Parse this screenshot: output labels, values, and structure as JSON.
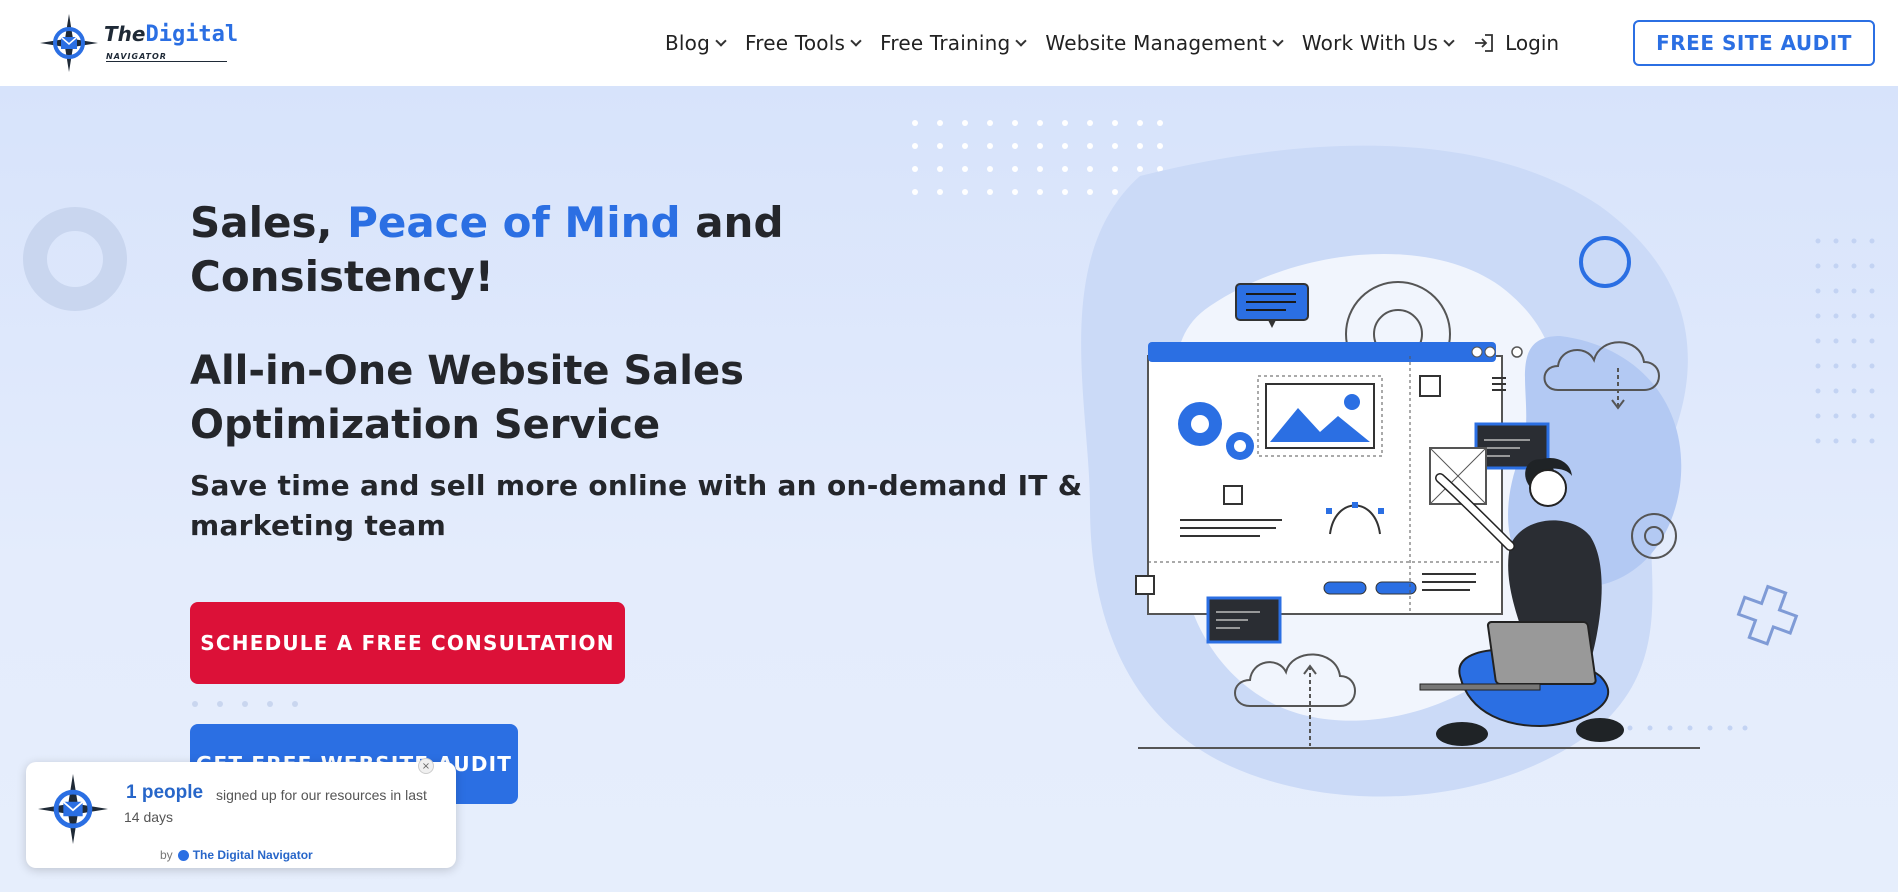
{
  "brand": {
    "logo_main_1": "The",
    "logo_main_2": "Digital",
    "logo_sub": "NAVIGATOR"
  },
  "nav": {
    "items": [
      {
        "label": "Blog"
      },
      {
        "label": "Free Tools"
      },
      {
        "label": "Free Training"
      },
      {
        "label": "Website Management"
      },
      {
        "label": "Work With Us"
      }
    ],
    "login_label": "Login",
    "cta_label": "FREE SITE AUDIT"
  },
  "hero": {
    "headline_part1": "Sales, ",
    "headline_accent": "Peace of Mind",
    "headline_part2": " and Consistency!",
    "subheadline": "All-in-One Website Sales Optimization Service",
    "tagline": "Save time and sell more online with an on-demand IT & marketing team",
    "primary_button": "SCHEDULE A FREE CONSULTATION",
    "secondary_button": "GET FREE WEBSITE AUDIT"
  },
  "notification": {
    "count": "1 people",
    "text": "signed up for our resources in last",
    "period": "14 days",
    "by_label": "by",
    "by_brand": "The Digital Navigator",
    "close": "×"
  },
  "colors": {
    "accent": "#2b6fe3",
    "cta_red": "#dc1138",
    "text_dark": "#24262b"
  }
}
